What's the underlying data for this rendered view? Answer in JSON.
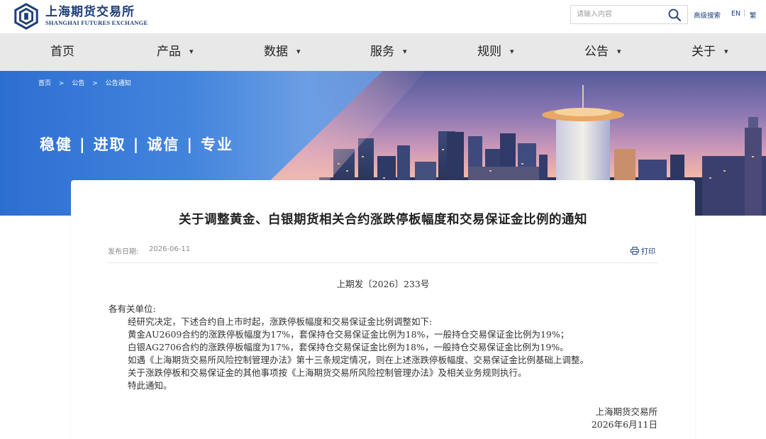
{
  "header": {
    "logo_cn": "上海期货交易所",
    "logo_en": "SHANGHAI FUTURES EXCHANGE",
    "search_placeholder": "请输入内容",
    "advanced_search": "高级搜索",
    "lang_en": "EN",
    "lang_separator": "|",
    "lang_traditional": "繁",
    "brand_color": "#1e3f7a"
  },
  "nav": {
    "items": [
      {
        "label": "首页",
        "has_dropdown": false
      },
      {
        "label": "产品",
        "has_dropdown": true
      },
      {
        "label": "数据",
        "has_dropdown": true
      },
      {
        "label": "服务",
        "has_dropdown": true
      },
      {
        "label": "规则",
        "has_dropdown": true
      },
      {
        "label": "公告",
        "has_dropdown": true
      },
      {
        "label": "关于",
        "has_dropdown": true
      }
    ]
  },
  "banner": {
    "breadcrumb": [
      "首页",
      "公告",
      "公告通知"
    ],
    "breadcrumb_separator": ">",
    "slogan": [
      "稳健",
      "进取",
      "诚信",
      "专业"
    ],
    "slogan_separator": "|"
  },
  "article": {
    "title": "关于调整黄金、白银期货相关合约涨跌停板幅度和交易保证金比例的通知",
    "publish_label": "发布日期:",
    "publish_date": "2026-06-11",
    "print_label": "打印",
    "doc_number": "上期发〔2026〕233号",
    "salutation": "各有关单位:",
    "paragraphs": [
      "经研究决定，下述合约自上市时起，涨跌停板幅度和交易保证金比例调整如下:",
      "黄金AU2609合约的涨跌停板幅度为17%，套保持仓交易保证金比例为18%，一般持仓交易保证金比例为19%；",
      "白银AG2706合约的涨跌停板幅度为17%，套保持仓交易保证金比例为18%，一般持仓交易保证金比例为19%。",
      "如遇《上海期货交易所风险控制管理办法》第十三条规定情况，则在上述涨跌停板幅度、交易保证金比例基础上调整。",
      "关于涨跌停板和交易保证金的其他事项按《上海期货交易所风险控制管理办法》及相关业务规则执行。",
      "特此通知。"
    ],
    "signature_org": "上海期货交易所",
    "signature_date": "2026年6月11日"
  }
}
